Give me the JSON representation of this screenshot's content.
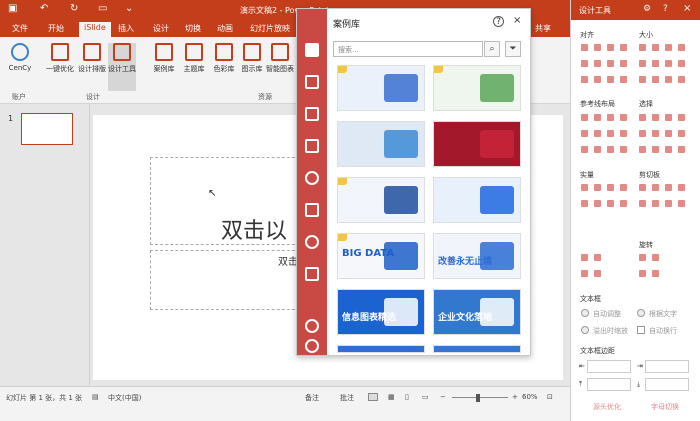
{
  "window": {
    "title": "演示文稿2 - PowerPoint",
    "tabs": [
      "文件",
      "开始",
      "iSlide",
      "插入",
      "设计",
      "切换",
      "动画",
      "幻灯片放映"
    ],
    "share": "共享"
  },
  "ribbon": {
    "account": {
      "name": "CenCy",
      "group": "账户"
    },
    "design_group": {
      "label": "设计",
      "buttons": [
        "一键优化",
        "设计排版",
        "设计工具"
      ]
    },
    "resources_group": {
      "label": "资源",
      "buttons": [
        "案例库",
        "主题库",
        "色彩库",
        "图示库",
        "智能图表"
      ]
    }
  },
  "slides": {
    "number": "1"
  },
  "slide_content": {
    "title_partial": "双击以",
    "subtitle_partial": "双击"
  },
  "status": {
    "slide_info": "幻灯片 第 1 张，共 1 张",
    "language": "中文(中国)",
    "notes": "备注",
    "comments": "批注",
    "zoom": "60%"
  },
  "case_library": {
    "title": "案例库",
    "search_placeholder": "搜索...",
    "cards": [
      {
        "text": "",
        "bg": "#eaf1fb",
        "accent": "#3a6fd0",
        "vip": true
      },
      {
        "text": "",
        "bg": "#eef6ee",
        "accent": "#5aa65a",
        "vip": true
      },
      {
        "text": "",
        "bg": "#dfe9f5",
        "accent": "#3d8bd6",
        "vip": false
      },
      {
        "text": "",
        "bg": "#a3182a",
        "accent": "#c9253a",
        "vip": false
      },
      {
        "text": "",
        "bg": "#f2f5fb",
        "accent": "#1f4f9c",
        "vip": true
      },
      {
        "text": "",
        "bg": "#e8f0fc",
        "accent": "#1e66e0",
        "vip": false
      },
      {
        "text": "BIG DATA",
        "bg": "#f5f7fb",
        "accent": "#1f5fc7",
        "vip": true
      },
      {
        "text": "改善永无止境",
        "bg": "#f1f5fb",
        "accent": "#2a6bd4",
        "vip": false
      },
      {
        "text": "信息图表精选",
        "bg": "#1a63d0",
        "accent": "#ffffff",
        "vip": false
      },
      {
        "text": "企业文化落地",
        "bg": "#3378cf",
        "accent": "#ffffff",
        "vip": false
      },
      {
        "text": "",
        "bg": "#2d6fd0",
        "accent": "#ffffff",
        "vip": false
      },
      {
        "text": "",
        "bg": "#3378cf",
        "accent": "#ffffff",
        "vip": false
      }
    ]
  },
  "design_tools": {
    "title": "设计工具",
    "sections": {
      "align": "对齐",
      "size": "大小",
      "guides": "参考线布局",
      "select": "选择",
      "fill": "实量",
      "clipboard": "剪切板",
      "rotate": "旋转",
      "text_box": "文本框",
      "text_margin": "文本框边距"
    },
    "radio_labels": [
      "自动调整",
      "根据文字",
      "溢出时缩放"
    ],
    "checkbox_label": "自动换行",
    "footer": [
      "源头优化",
      "字母切换"
    ]
  },
  "colors": {
    "brand": "#c43e1c",
    "panel": "#c94a45"
  }
}
